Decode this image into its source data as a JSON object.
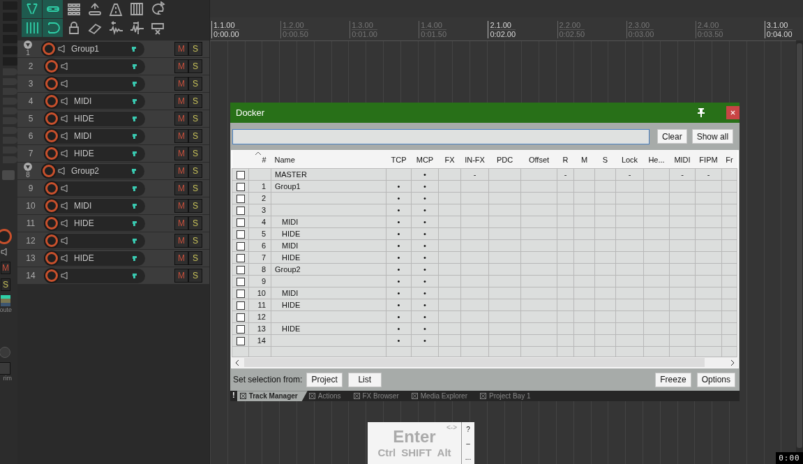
{
  "toolbar": {
    "buttons": [
      {
        "on": true
      },
      {
        "on": true
      },
      {
        "on": false
      },
      {
        "on": false
      },
      {
        "on": false
      },
      {
        "on": false
      },
      {
        "on": false
      },
      {
        "on": true
      },
      {
        "on": true
      },
      {
        "on": false
      },
      {
        "on": false
      },
      {
        "on": false
      },
      {
        "on": false
      },
      {
        "on": false
      }
    ]
  },
  "mixer_strip": {
    "mute": "M",
    "solo": "S",
    "route_label": "oute",
    "trim_label": "rim"
  },
  "tracks": [
    {
      "number": "1",
      "name": "Group1",
      "mute": "M",
      "solo": "S",
      "expanded": true,
      "children": [
        {
          "number": "2",
          "mute": "M",
          "solo": "S"
        },
        {
          "number": "3",
          "mute": "M",
          "solo": "S"
        },
        {
          "number": "4",
          "name": "MIDI",
          "mute": "M",
          "solo": "S"
        },
        {
          "number": "5",
          "name": "HIDE",
          "mute": "M",
          "solo": "S"
        },
        {
          "number": "6",
          "name": "MIDI",
          "mute": "M",
          "solo": "S"
        },
        {
          "number": "7",
          "name": "HIDE",
          "mute": "M",
          "solo": "S"
        }
      ]
    },
    {
      "number": "8",
      "name": "Group2",
      "mute": "M",
      "solo": "S",
      "expanded": true,
      "children": [
        {
          "number": "9",
          "mute": "M",
          "solo": "S"
        },
        {
          "number": "10",
          "name": "MIDI",
          "mute": "M",
          "solo": "S"
        },
        {
          "number": "11",
          "name": "HIDE",
          "mute": "M",
          "solo": "S"
        },
        {
          "number": "12",
          "mute": "M",
          "solo": "S"
        },
        {
          "number": "13",
          "name": "HIDE",
          "mute": "M",
          "solo": "S"
        },
        {
          "number": "14",
          "mute": "M",
          "solo": "S"
        }
      ]
    }
  ],
  "ruler": {
    "marks": [
      {
        "bar": "1.1.00",
        "time": "0:00.00",
        "major": true
      },
      {
        "bar": "1.2.00",
        "time": "0:00.50",
        "major": false
      },
      {
        "bar": "1.3.00",
        "time": "0:01.00",
        "major": false
      },
      {
        "bar": "1.4.00",
        "time": "0:01.50",
        "major": false
      },
      {
        "bar": "2.1.00",
        "time": "0:02.00",
        "major": true
      },
      {
        "bar": "2.2.00",
        "time": "0:02.50",
        "major": false
      },
      {
        "bar": "2.3.00",
        "time": "0:03.00",
        "major": false
      },
      {
        "bar": "2.4.00",
        "time": "0:03.50",
        "major": false
      },
      {
        "bar": "3.1.00",
        "time": "0:04.00",
        "major": true
      }
    ]
  },
  "docker": {
    "title": "Docker",
    "clear_button": "Clear",
    "show_all_button": "Show all",
    "columns": [
      {
        "label": "#",
        "sorted": true
      },
      {
        "label": "Name",
        "sorted": false
      },
      {
        "label": "TCP",
        "sorted": false
      },
      {
        "label": "MCP",
        "sorted": false
      },
      {
        "label": "FX",
        "sorted": false
      },
      {
        "label": "IN-FX",
        "sorted": false
      },
      {
        "label": "PDC",
        "sorted": false
      },
      {
        "label": "Offset",
        "sorted": false
      },
      {
        "label": "R",
        "sorted": false
      },
      {
        "label": "M",
        "sorted": false
      },
      {
        "label": "S",
        "sorted": false
      },
      {
        "label": "Lock",
        "sorted": false
      },
      {
        "label": "He...",
        "sorted": false
      },
      {
        "label": "MIDI",
        "sorted": false
      },
      {
        "label": "FIPM",
        "sorted": false
      },
      {
        "label": "Fr",
        "sorted": false
      }
    ],
    "rows": [
      {
        "checked": false,
        "cells": [
          "",
          "MASTER",
          "",
          "•",
          "",
          "-",
          "",
          "",
          "-",
          "",
          "",
          "-",
          "",
          "-",
          "-",
          ""
        ]
      },
      {
        "checked": false,
        "cells": [
          "1",
          "Group1",
          "•",
          "•",
          "",
          "",
          "",
          "",
          "",
          "",
          "",
          "",
          "",
          "",
          "",
          ""
        ],
        "children": [
          {
            "checked": false,
            "cells": [
              "2",
              "",
              "•",
              "•",
              "",
              "",
              "",
              "",
              "",
              "",
              "",
              "",
              "",
              "",
              "",
              ""
            ]
          },
          {
            "checked": false,
            "cells": [
              "3",
              "",
              "•",
              "•",
              "",
              "",
              "",
              "",
              "",
              "",
              "",
              "",
              "",
              "",
              "",
              ""
            ]
          },
          {
            "checked": false,
            "cells": [
              "4",
              "MIDI",
              "•",
              "•",
              "",
              "",
              "",
              "",
              "",
              "",
              "",
              "",
              "",
              "",
              "",
              ""
            ]
          },
          {
            "checked": false,
            "cells": [
              "5",
              "HIDE",
              "•",
              "•",
              "",
              "",
              "",
              "",
              "",
              "",
              "",
              "",
              "",
              "",
              "",
              ""
            ]
          },
          {
            "checked": false,
            "cells": [
              "6",
              "MIDI",
              "•",
              "•",
              "",
              "",
              "",
              "",
              "",
              "",
              "",
              "",
              "",
              "",
              "",
              ""
            ]
          },
          {
            "checked": false,
            "cells": [
              "7",
              "HIDE",
              "•",
              "•",
              "",
              "",
              "",
              "",
              "",
              "",
              "",
              "",
              "",
              "",
              "",
              ""
            ]
          }
        ]
      },
      {
        "checked": false,
        "cells": [
          "8",
          "Group2",
          "•",
          "•",
          "",
          "",
          "",
          "",
          "",
          "",
          "",
          "",
          "",
          "",
          "",
          ""
        ],
        "children": [
          {
            "checked": false,
            "cells": [
              "9",
              "",
              "•",
              "•",
              "",
              "",
              "",
              "",
              "",
              "",
              "",
              "",
              "",
              "",
              "",
              ""
            ]
          },
          {
            "checked": false,
            "cells": [
              "10",
              "MIDI",
              "•",
              "•",
              "",
              "",
              "",
              "",
              "",
              "",
              "",
              "",
              "",
              "",
              "",
              ""
            ]
          },
          {
            "checked": false,
            "cells": [
              "11",
              "HIDE",
              "•",
              "•",
              "",
              "",
              "",
              "",
              "",
              "",
              "",
              "",
              "",
              "",
              "",
              ""
            ]
          },
          {
            "checked": false,
            "cells": [
              "12",
              "",
              "•",
              "•",
              "",
              "",
              "",
              "",
              "",
              "",
              "",
              "",
              "",
              "",
              "",
              ""
            ]
          },
          {
            "checked": false,
            "cells": [
              "13",
              "HIDE",
              "•",
              "•",
              "",
              "",
              "",
              "",
              "",
              "",
              "",
              "",
              "",
              "",
              "",
              ""
            ]
          },
          {
            "checked": false,
            "cells": [
              "14",
              "",
              "•",
              "•",
              "",
              "",
              "",
              "",
              "",
              "",
              "",
              "",
              "",
              "",
              "",
              ""
            ]
          }
        ]
      }
    ],
    "selection_label": "Set selection from:",
    "footer_buttons": [
      "Project",
      "List"
    ],
    "right_buttons": [
      "Freeze",
      "Options"
    ],
    "warning_mark": "!",
    "tabs": [
      {
        "label": "Track Manager",
        "selected": true
      },
      {
        "label": "Actions",
        "selected": false
      },
      {
        "label": "FX Browser",
        "selected": false
      },
      {
        "label": "Media Explorer",
        "selected": false
      },
      {
        "label": "Project Bay 1",
        "selected": false
      }
    ]
  },
  "key_overlay": {
    "key": "Enter",
    "modifiers": [
      "Ctrl",
      "SHIFT",
      "Alt"
    ],
    "arrows": "<->",
    "side": [
      "?",
      "–",
      "..."
    ]
  },
  "time_display": "0:00"
}
